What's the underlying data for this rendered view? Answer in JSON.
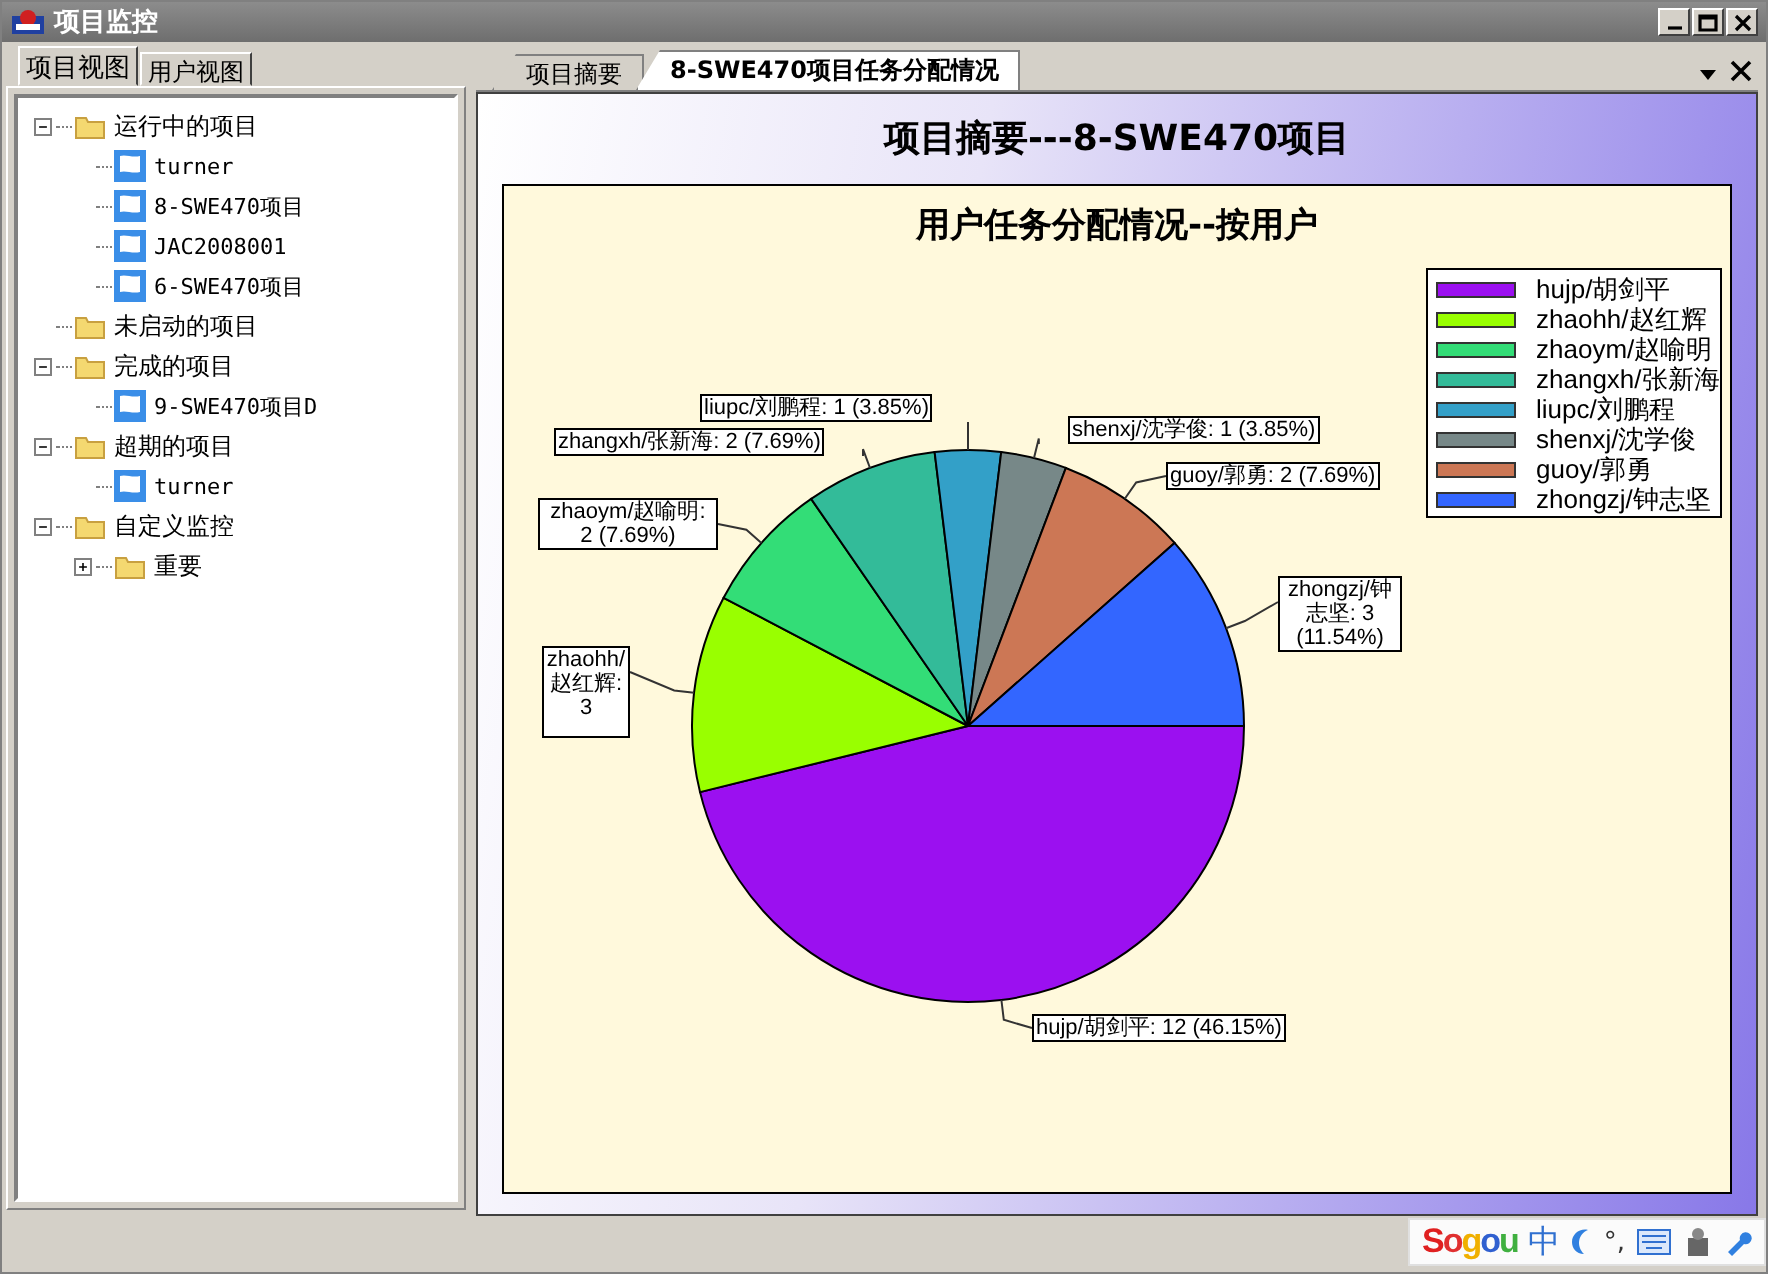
{
  "window": {
    "title": "项目监控"
  },
  "left_tabs": [
    {
      "label": "项目视图",
      "selected": true
    },
    {
      "label": "用户视图",
      "selected": false
    }
  ],
  "tree": [
    {
      "label": "运行中的项目",
      "kind": "folder",
      "expanded": true,
      "children": [
        {
          "label": "turner",
          "kind": "project"
        },
        {
          "label": "8-SWE470项目",
          "kind": "project"
        },
        {
          "label": "JAC2008001",
          "kind": "project"
        },
        {
          "label": "6-SWE470项目",
          "kind": "project"
        }
      ]
    },
    {
      "label": "未启动的项目",
      "kind": "folder"
    },
    {
      "label": "完成的项目",
      "kind": "folder",
      "expanded": true,
      "children": [
        {
          "label": "9-SWE470项目D",
          "kind": "project"
        }
      ]
    },
    {
      "label": "超期的项目",
      "kind": "folder",
      "expanded": true,
      "children": [
        {
          "label": "turner",
          "kind": "project"
        }
      ]
    },
    {
      "label": "自定义监控",
      "kind": "folder",
      "expanded": true,
      "children": [
        {
          "label": "重要",
          "kind": "folder",
          "expanded": false
        }
      ]
    }
  ],
  "doc_tabs": [
    {
      "label": "项目摘要",
      "selected": false
    },
    {
      "label": "8-SWE470项目任务分配情况",
      "selected": true
    }
  ],
  "content": {
    "heading": "项目摘要---8-SWE470项目",
    "chart_data": {
      "type": "pie",
      "title": "用户任务分配情况--按用户",
      "categories": [
        "hujp/胡剑平",
        "zhaohh/赵红辉",
        "zhaoym/赵喻明",
        "zhangxh/张新海",
        "liupc/刘鹏程",
        "shenxj/沈学俊",
        "guoy/郭勇",
        "zhongzj/钟志坚"
      ],
      "series": [
        {
          "values": [
            46.15,
            11.54,
            7.69,
            7.69,
            3.85,
            3.85,
            7.69,
            11.54
          ]
        }
      ],
      "legend": "right",
      "colors": [
        "#9b10f0",
        "#99ff00",
        "#33dd77",
        "#33bb99",
        "#33a0c8",
        "#778888",
        "#cc7755",
        "#3366ff"
      ]
    },
    "slice_labels": [
      "liupc/刘鹏程: 1 (3.85%)",
      "shenxj/沈学俊: 1 (3.85%)",
      "zhangxh/张新海: 2 (7.69%)",
      "guoy/郭勇: 2 (7.69%)",
      "zhaoym/赵喻明: 2 (7.69%)",
      "zhongzj/钟志坚: 3 (11.54%)",
      "zhaohh/赵红辉: 3",
      "hujp/胡剑平: 12 (46.15%)"
    ]
  },
  "ime_bar": {
    "logo": "Sogou",
    "mode": "中",
    "punctuation": "°,"
  }
}
